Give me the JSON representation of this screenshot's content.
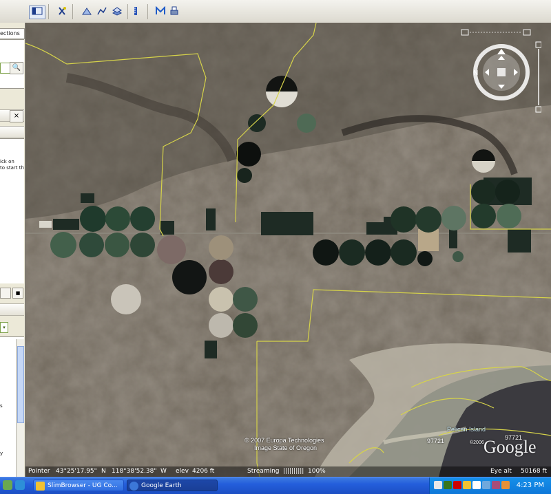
{
  "toolbar": {
    "buttons": [
      {
        "name": "sidebar-toggle-icon"
      },
      {
        "name": "placemark-tool-icon"
      },
      {
        "name": "polygon-tool-icon"
      },
      {
        "name": "path-tool-icon"
      },
      {
        "name": "image-overlay-icon"
      },
      {
        "name": "ruler-icon"
      },
      {
        "name": "email-icon"
      },
      {
        "name": "print-icon"
      }
    ]
  },
  "sidebar": {
    "search_tab_label": "ections",
    "search_button_label": "🔍",
    "close_label": "×",
    "hint_line1": "ick on",
    "hint_line2": "to start th",
    "stop_label": "■",
    "dropdown_label": "▾",
    "letter1": "s",
    "letter2": "y"
  },
  "map": {
    "copyright_line1": "© 2007 Europa Technologies",
    "copyright_line2": "Image State of Oregon",
    "place_label": "Pelican Island",
    "zip_label_1": "97721",
    "zip_label_2": "97721",
    "year_label": "©2006",
    "logo_text": "Google"
  },
  "status": {
    "pointer_label": "Pointer",
    "lat": "43°25'17.95\"",
    "lat_dir": "N",
    "lon": "118°38'52.38\"",
    "lon_dir": "W",
    "elev_label": "elev",
    "elev_value": "4206 ft",
    "streaming_label": "Streaming",
    "streaming_bar": "||||||||||",
    "streaming_pct": "100%",
    "eye_label": "Eye alt",
    "eye_value": "50168 ft"
  },
  "taskbar": {
    "task1": "SlimBrowser - UG Co...",
    "task2": "Google Earth",
    "clock": "4:23 PM"
  },
  "colors": {
    "terrain": "#625b50",
    "border_line": "#d6d34a",
    "taskbar": "#245edb",
    "tray": "#0e78d9"
  }
}
